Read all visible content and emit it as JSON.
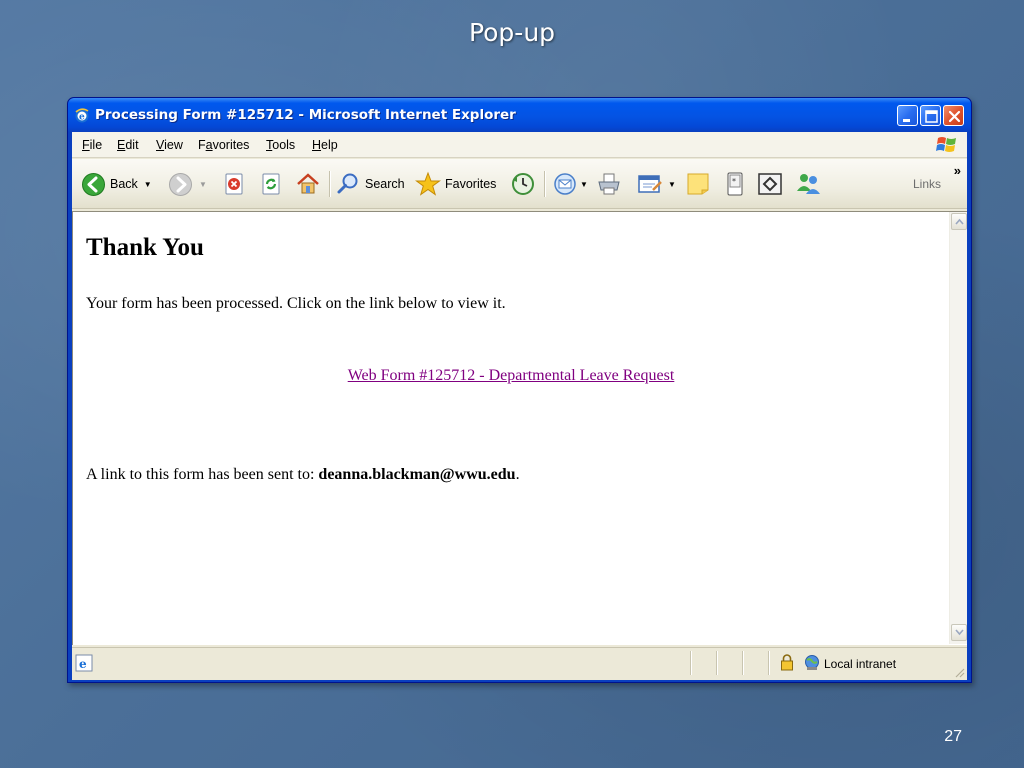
{
  "slide": {
    "title": "Pop-up",
    "number": "27"
  },
  "window": {
    "title": "Processing Form #125712 - Microsoft Internet Explorer",
    "icon": "ie-icon",
    "controls": [
      "minimize-icon",
      "maximize-icon",
      "close-icon"
    ]
  },
  "menu": {
    "items": [
      {
        "underline": "F",
        "rest": "ile"
      },
      {
        "underline": "E",
        "rest": "dit"
      },
      {
        "underline": "V",
        "rest": "iew"
      },
      {
        "pre": "F",
        "underline": "a",
        "rest": "vorites"
      },
      {
        "underline": "T",
        "rest": "ools"
      },
      {
        "underline": "H",
        "rest": "elp"
      }
    ]
  },
  "toolbar": {
    "back_label": "Back",
    "search_label": "Search",
    "favorites_label": "Favorites",
    "links_label": "Links",
    "chevron": "»"
  },
  "page": {
    "heading": "Thank You",
    "message": "Your form has been processed. Click on the link below to view it.",
    "form_link": "Web Form #125712 - Departmental Leave Request",
    "sent_prefix": "A link to this form has been sent to: ",
    "sent_email": "deanna.blackman@wwu.edu",
    "sent_suffix": "."
  },
  "status": {
    "zone": "Local intranet"
  },
  "colors": {
    "titlebar": "#0453e3",
    "visited_link": "#800080",
    "slide_background": "#4b6f98"
  }
}
